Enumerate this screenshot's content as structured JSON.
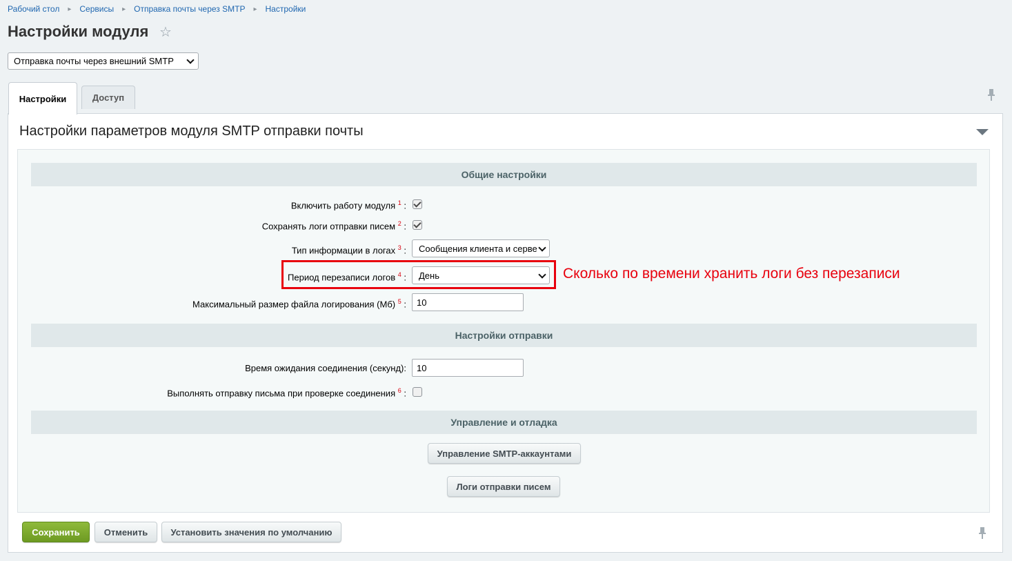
{
  "breadcrumb": [
    "Рабочий стол",
    "Сервисы",
    "Отправка почты через SMTP",
    "Настройки"
  ],
  "page_title": "Настройки модуля",
  "module_select": {
    "value": "Отправка почты через внешний SMTP"
  },
  "tabs": [
    "Настройки",
    "Доступ"
  ],
  "panel_title": "Настройки параметров модуля SMTP отправки почты",
  "sections": {
    "general": "Общие настройки",
    "sending": "Настройки отправки",
    "management": "Управление и отладка"
  },
  "fields": {
    "enable_module": {
      "label": "Включить работу модуля",
      "footnote": "1",
      "checked": true
    },
    "save_logs": {
      "label": "Сохранять логи отправки писем",
      "footnote": "2",
      "checked": true
    },
    "log_info_type": {
      "label": "Тип информации в логах",
      "footnote": "3",
      "value": "Сообщения клиента и серве"
    },
    "log_period": {
      "label": "Период перезаписи логов",
      "footnote": "4",
      "value": "День"
    },
    "max_log_size": {
      "label": "Максимальный размер файла логирования (Мб)",
      "footnote": "5",
      "value": "10"
    },
    "timeout": {
      "label": "Время ожидания соединения (секунд):",
      "value": "10"
    },
    "send_on_check": {
      "label": "Выполнять отправку письма при проверке соединения",
      "footnote": "6",
      "checked": false
    }
  },
  "label_suffix": ":",
  "annotation": "Сколько по времени хранить логи без перезаписи",
  "buttons": {
    "manage_accounts": "Управление SMTP-аккаунтами",
    "send_logs": "Логи отправки писем",
    "save": "Сохранить",
    "cancel": "Отменить",
    "defaults": "Установить значения по умолчанию"
  },
  "colors": {
    "accent": "#2067b0",
    "highlight": "#e8000d",
    "save_green": "#7aa72c"
  }
}
